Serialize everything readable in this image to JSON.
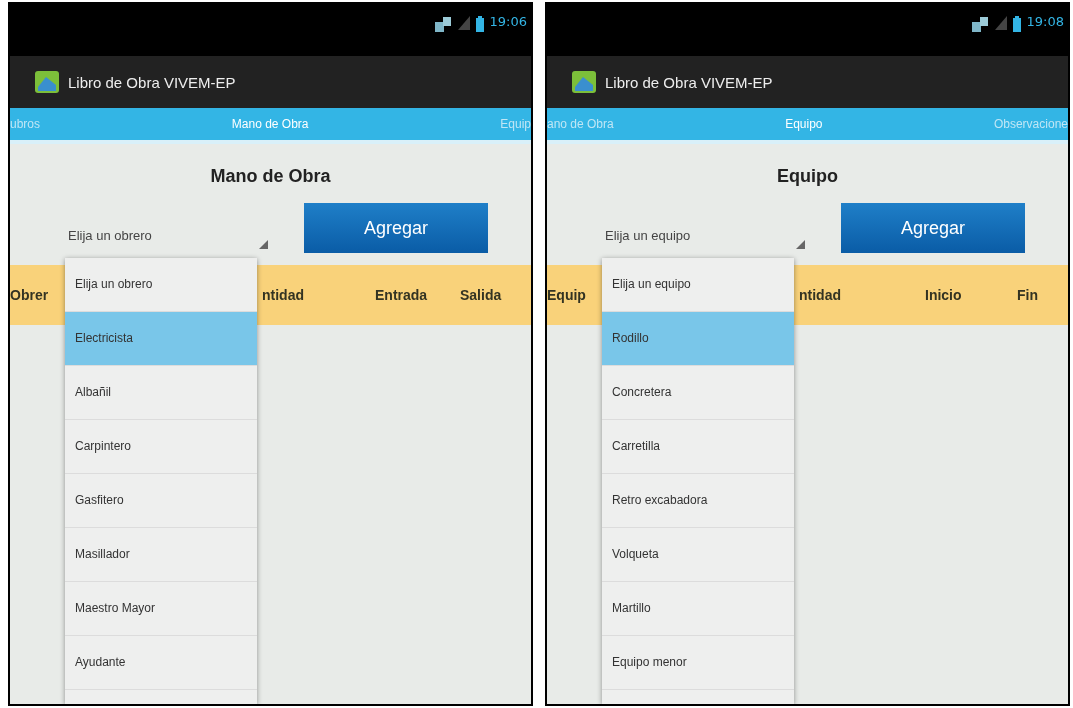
{
  "phones": [
    {
      "status_time": "19:06",
      "app_title": "Libro de Obra VIVEM-EP",
      "tabs": [
        {
          "label": "ubros",
          "selected": false
        },
        {
          "label": "Mano de Obra",
          "selected": true
        },
        {
          "label": "Equip",
          "selected": false
        }
      ],
      "heading": "Mano de Obra",
      "spinner": {
        "value": "Elija un obrero"
      },
      "button": "Agregar",
      "table_columns": [
        "Obrer",
        "ntidad",
        "Entrada",
        "Salida"
      ],
      "dropdown": [
        {
          "label": "Elija un obrero",
          "selected": false
        },
        {
          "label": "Electricista",
          "selected": true
        },
        {
          "label": "Albañil",
          "selected": false
        },
        {
          "label": "Carpintero",
          "selected": false
        },
        {
          "label": "Gasfitero",
          "selected": false
        },
        {
          "label": "Masillador",
          "selected": false
        },
        {
          "label": "Maestro Mayor",
          "selected": false
        },
        {
          "label": "Ayudante",
          "selected": false
        }
      ]
    },
    {
      "status_time": "19:08",
      "app_title": "Libro de Obra VIVEM-EP",
      "tabs": [
        {
          "label": "ano de Obra",
          "selected": false
        },
        {
          "label": "Equipo",
          "selected": true
        },
        {
          "label": "Observacione",
          "selected": false
        }
      ],
      "heading": "Equipo",
      "spinner": {
        "value": "Elija un equipo"
      },
      "button": "Agregar",
      "table_columns": [
        "Equip",
        "ntidad",
        "Inicio",
        "Fin"
      ],
      "dropdown": [
        {
          "label": "Elija un equipo",
          "selected": false
        },
        {
          "label": "Rodillo",
          "selected": true
        },
        {
          "label": "Concretera",
          "selected": false
        },
        {
          "label": "Carretilla",
          "selected": false
        },
        {
          "label": "Retro excabadora",
          "selected": false
        },
        {
          "label": "Volqueta",
          "selected": false
        },
        {
          "label": "Martillo",
          "selected": false
        },
        {
          "label": "Equipo menor",
          "selected": false
        }
      ]
    }
  ]
}
